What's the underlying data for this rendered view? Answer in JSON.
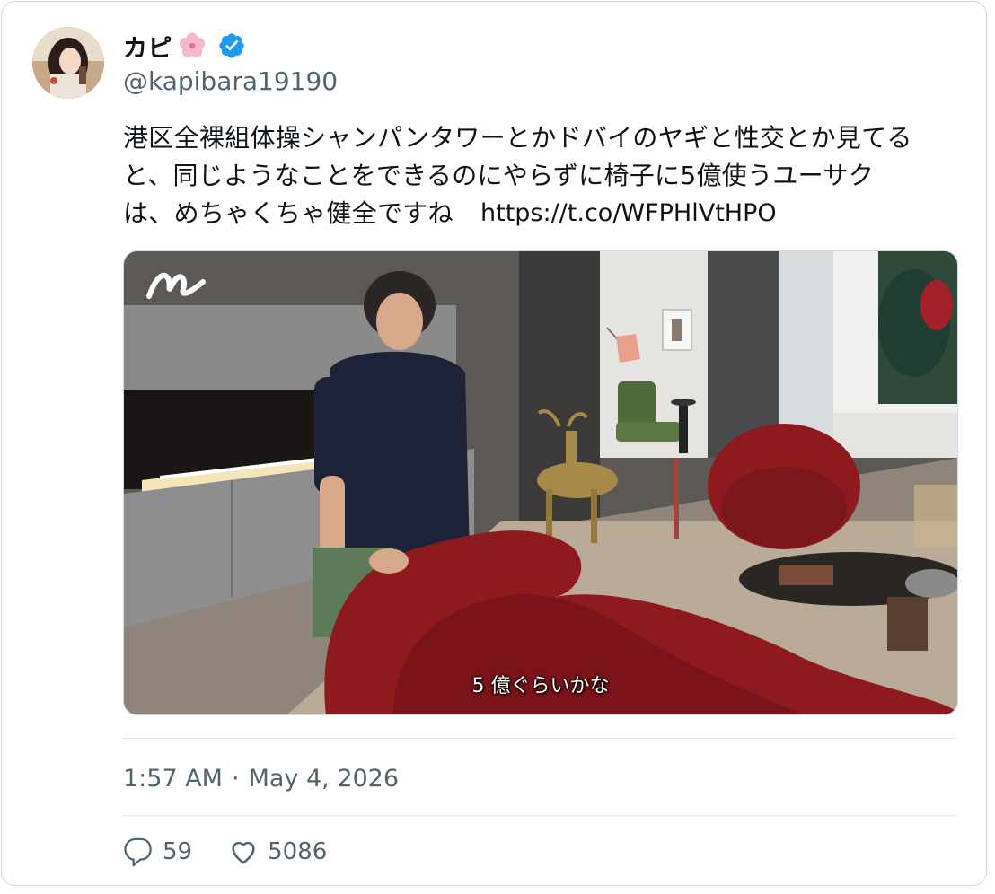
{
  "tweet": {
    "display_name": "カピ",
    "handle": "@kapibara19190",
    "name_emoji_icon": "cherry-blossom-icon",
    "verified_icon": "verified-badge-icon",
    "text": "港区全裸組体操シャンパンタワーとかドバイのヤギと性交とか見てる\nと、同じようなことをできるのにやらずに椅子に5億使うユーサク\nは、めちゃくちゃ健全ですね",
    "link": "https://t.co/WFPHlVtHPO",
    "media_subtitle": "5 億ぐらいかな",
    "time": "1:57 AM",
    "separator": "·",
    "date": "May 4, 2026",
    "reply_count": "59",
    "like_count": "5086"
  },
  "colors": {
    "verified": "#1d9bf0",
    "secondary_text": "#536471",
    "primary_text": "#0f1419",
    "border": "#cfd9de",
    "sofa_red": "#8e1a20"
  }
}
